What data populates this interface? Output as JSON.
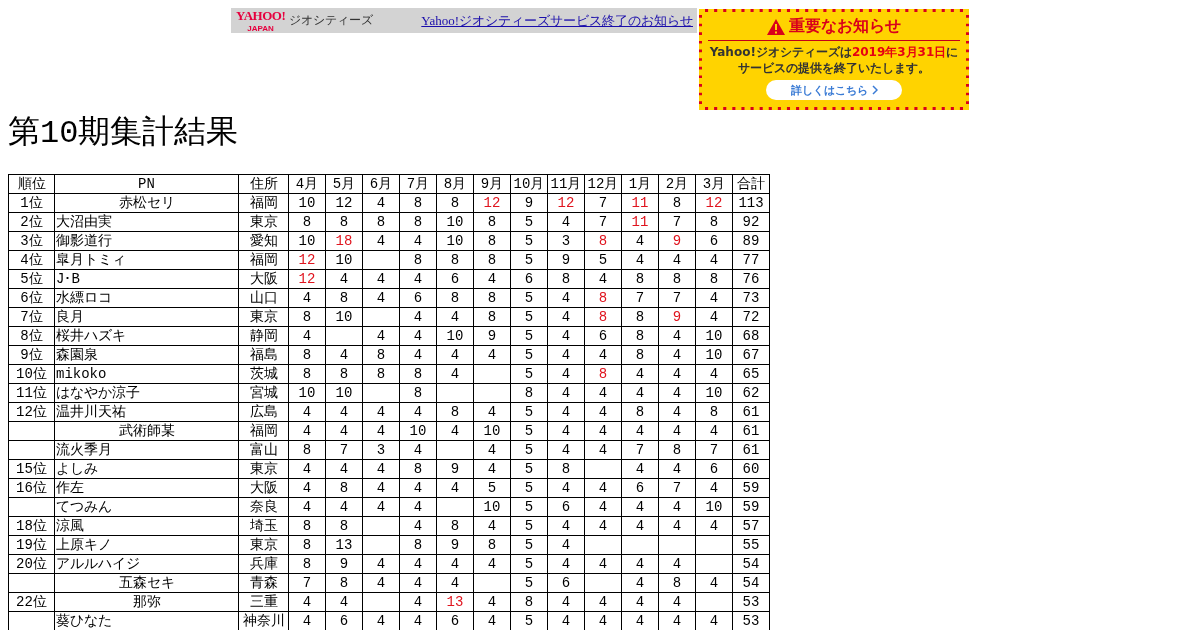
{
  "topbar": {
    "logo": "YAHOO!",
    "logo_sub": "JAPAN",
    "service": "ジオシティーズ",
    "link": "Yahoo!ジオシティーズサービス終了のお知らせ"
  },
  "notice": {
    "title": "重要なお知らせ",
    "message_before": "Yahoo!ジオシティーズは",
    "date": "2019年3月31日",
    "message_mid": "に",
    "message_after": "サービスの提供を終了いたします。",
    "button": "詳しくはこちら"
  },
  "heading": "第10期集計結果",
  "table": {
    "columns": [
      "順位",
      "PN",
      "住所",
      "4月",
      "5月",
      "6月",
      "7月",
      "8月",
      "9月",
      "10月",
      "11月",
      "12月",
      "1月",
      "2月",
      "3月",
      "合計"
    ],
    "rows": [
      {
        "rank": "1位",
        "name": "赤松セリ",
        "centered": true,
        "place": "福岡",
        "scores": [
          {
            "kind": "score",
            "text": "10",
            "highlight": false
          },
          {
            "kind": "score",
            "text": "12",
            "highlight": false
          },
          {
            "kind": "score",
            "text": "4",
            "highlight": false
          },
          {
            "kind": "score",
            "text": "8",
            "highlight": false
          },
          {
            "kind": "score",
            "text": "8",
            "highlight": false
          },
          {
            "kind": "score",
            "text": "12",
            "highlight": true
          },
          {
            "kind": "score",
            "text": "9",
            "highlight": false
          },
          {
            "kind": "score",
            "text": "12",
            "highlight": true
          },
          {
            "kind": "score",
            "text": "7",
            "highlight": false
          },
          {
            "kind": "score",
            "text": "11",
            "highlight": true
          },
          {
            "kind": "score",
            "text": "8",
            "highlight": false
          },
          {
            "kind": "score",
            "text": "12",
            "highlight": true
          }
        ],
        "total": "113"
      },
      {
        "rank": "2位",
        "name": "大沼由実",
        "centered": false,
        "place": "東京",
        "scores": [
          {
            "kind": "score",
            "text": "8",
            "highlight": false
          },
          {
            "kind": "score",
            "text": "8",
            "highlight": false
          },
          {
            "kind": "score",
            "text": "8",
            "highlight": false
          },
          {
            "kind": "score",
            "text": "8",
            "highlight": false
          },
          {
            "kind": "score",
            "text": "10",
            "highlight": false
          },
          {
            "kind": "score",
            "text": "8",
            "highlight": false
          },
          {
            "kind": "score",
            "text": "5",
            "highlight": false
          },
          {
            "kind": "score",
            "text": "4",
            "highlight": false
          },
          {
            "kind": "score",
            "text": "7",
            "highlight": false
          },
          {
            "kind": "score",
            "text": "11",
            "highlight": true
          },
          {
            "kind": "score",
            "text": "7",
            "highlight": false
          },
          {
            "kind": "score",
            "text": "8",
            "highlight": false
          }
        ],
        "total": "92"
      },
      {
        "rank": "3位",
        "name": "御影道行",
        "centered": false,
        "place": "愛知",
        "scores": [
          {
            "kind": "score",
            "text": "10",
            "highlight": false
          },
          {
            "kind": "score",
            "text": "18",
            "highlight": true
          },
          {
            "kind": "score",
            "text": "4",
            "highlight": false
          },
          {
            "kind": "score",
            "text": "4",
            "highlight": false
          },
          {
            "kind": "score",
            "text": "10",
            "highlight": false
          },
          {
            "kind": "score",
            "text": "8",
            "highlight": false
          },
          {
            "kind": "score",
            "text": "5",
            "highlight": false
          },
          {
            "kind": "score",
            "text": "3",
            "highlight": false
          },
          {
            "kind": "score",
            "text": "8",
            "highlight": true
          },
          {
            "kind": "score",
            "text": "4",
            "highlight": false
          },
          {
            "kind": "score",
            "text": "9",
            "highlight": true
          },
          {
            "kind": "score",
            "text": "6",
            "highlight": false
          }
        ],
        "total": "89"
      },
      {
        "rank": "4位",
        "name": "皐月トミィ",
        "centered": false,
        "place": "福岡",
        "scores": [
          {
            "kind": "score",
            "text": "12",
            "highlight": true
          },
          {
            "kind": "score",
            "text": "10",
            "highlight": false
          },
          {
            "kind": "blank"
          },
          {
            "kind": "score",
            "text": "8",
            "highlight": false
          },
          {
            "kind": "score",
            "text": "8",
            "highlight": false
          },
          {
            "kind": "score",
            "text": "8",
            "highlight": false
          },
          {
            "kind": "score",
            "text": "5",
            "highlight": false
          },
          {
            "kind": "score",
            "text": "9",
            "highlight": false
          },
          {
            "kind": "score",
            "text": "5",
            "highlight": false
          },
          {
            "kind": "score",
            "text": "4",
            "highlight": false
          },
          {
            "kind": "score",
            "text": "4",
            "highlight": false
          },
          {
            "kind": "score",
            "text": "4",
            "highlight": false
          }
        ],
        "total": "77"
      },
      {
        "rank": "5位",
        "name": "J･B",
        "centered": false,
        "place": "大阪",
        "scores": [
          {
            "kind": "score",
            "text": "12",
            "highlight": true
          },
          {
            "kind": "score",
            "text": "4",
            "highlight": false
          },
          {
            "kind": "score",
            "text": "4",
            "highlight": false
          },
          {
            "kind": "score",
            "text": "4",
            "highlight": false
          },
          {
            "kind": "score",
            "text": "6",
            "highlight": false
          },
          {
            "kind": "score",
            "text": "4",
            "highlight": false
          },
          {
            "kind": "score",
            "text": "6",
            "highlight": false
          },
          {
            "kind": "score",
            "text": "8",
            "highlight": false
          },
          {
            "kind": "score",
            "text": "4",
            "highlight": false
          },
          {
            "kind": "score",
            "text": "8",
            "highlight": false
          },
          {
            "kind": "score",
            "text": "8",
            "highlight": false
          },
          {
            "kind": "score",
            "text": "8",
            "highlight": false
          }
        ],
        "total": "76"
      },
      {
        "rank": "6位",
        "name": "水縹ロコ",
        "centered": false,
        "place": "山口",
        "scores": [
          {
            "kind": "score",
            "text": "4",
            "highlight": false
          },
          {
            "kind": "score",
            "text": "8",
            "highlight": false
          },
          {
            "kind": "score",
            "text": "4",
            "highlight": false
          },
          {
            "kind": "score",
            "text": "6",
            "highlight": false
          },
          {
            "kind": "score",
            "text": "8",
            "highlight": false
          },
          {
            "kind": "score",
            "text": "8",
            "highlight": false
          },
          {
            "kind": "score",
            "text": "5",
            "highlight": false
          },
          {
            "kind": "score",
            "text": "4",
            "highlight": false
          },
          {
            "kind": "score",
            "text": "8",
            "highlight": true
          },
          {
            "kind": "score",
            "text": "7",
            "highlight": false
          },
          {
            "kind": "score",
            "text": "7",
            "highlight": false
          },
          {
            "kind": "score",
            "text": "4",
            "highlight": false
          }
        ],
        "total": "73"
      },
      {
        "rank": "7位",
        "name": "良月",
        "centered": false,
        "place": "東京",
        "scores": [
          {
            "kind": "score",
            "text": "8",
            "highlight": false
          },
          {
            "kind": "score",
            "text": "10",
            "highlight": false
          },
          {
            "kind": "blank"
          },
          {
            "kind": "score",
            "text": "4",
            "highlight": false
          },
          {
            "kind": "score",
            "text": "4",
            "highlight": false
          },
          {
            "kind": "score",
            "text": "8",
            "highlight": false
          },
          {
            "kind": "score",
            "text": "5",
            "highlight": false
          },
          {
            "kind": "score",
            "text": "4",
            "highlight": false
          },
          {
            "kind": "score",
            "text": "8",
            "highlight": true
          },
          {
            "kind": "score",
            "text": "8",
            "highlight": false
          },
          {
            "kind": "score",
            "text": "9",
            "highlight": true
          },
          {
            "kind": "score",
            "text": "4",
            "highlight": false
          }
        ],
        "total": "72"
      },
      {
        "rank": "8位",
        "name": "桜井ハズキ",
        "centered": false,
        "place": "静岡",
        "scores": [
          {
            "kind": "score",
            "text": "4",
            "highlight": false
          },
          {
            "kind": "blank"
          },
          {
            "kind": "score",
            "text": "4",
            "highlight": false
          },
          {
            "kind": "score",
            "text": "4",
            "highlight": false
          },
          {
            "kind": "score",
            "text": "10",
            "highlight": false
          },
          {
            "kind": "score",
            "text": "9",
            "highlight": false
          },
          {
            "kind": "score",
            "text": "5",
            "highlight": false
          },
          {
            "kind": "score",
            "text": "4",
            "highlight": false
          },
          {
            "kind": "score",
            "text": "6",
            "highlight": false
          },
          {
            "kind": "score",
            "text": "8",
            "highlight": false
          },
          {
            "kind": "score",
            "text": "4",
            "highlight": false
          },
          {
            "kind": "score",
            "text": "10",
            "highlight": false
          }
        ],
        "total": "68"
      },
      {
        "rank": "9位",
        "name": "森園泉",
        "centered": false,
        "place": "福島",
        "scores": [
          {
            "kind": "score",
            "text": "8",
            "highlight": false
          },
          {
            "kind": "score",
            "text": "4",
            "highlight": false
          },
          {
            "kind": "score",
            "text": "8",
            "highlight": false
          },
          {
            "kind": "score",
            "text": "4",
            "highlight": false
          },
          {
            "kind": "score",
            "text": "4",
            "highlight": false
          },
          {
            "kind": "score",
            "text": "4",
            "highlight": false
          },
          {
            "kind": "score",
            "text": "5",
            "highlight": false
          },
          {
            "kind": "score",
            "text": "4",
            "highlight": false
          },
          {
            "kind": "score",
            "text": "4",
            "highlight": false
          },
          {
            "kind": "score",
            "text": "8",
            "highlight": false
          },
          {
            "kind": "score",
            "text": "4",
            "highlight": false
          },
          {
            "kind": "score",
            "text": "10",
            "highlight": false
          }
        ],
        "total": "67"
      },
      {
        "rank": "10位",
        "name": "mikoko",
        "centered": false,
        "place": "茨城",
        "scores": [
          {
            "kind": "score",
            "text": "8",
            "highlight": false
          },
          {
            "kind": "score",
            "text": "8",
            "highlight": false
          },
          {
            "kind": "score",
            "text": "8",
            "highlight": false
          },
          {
            "kind": "score",
            "text": "8",
            "highlight": false
          },
          {
            "kind": "score",
            "text": "4",
            "highlight": false
          },
          {
            "kind": "blank"
          },
          {
            "kind": "score",
            "text": "5",
            "highlight": false
          },
          {
            "kind": "score",
            "text": "4",
            "highlight": false
          },
          {
            "kind": "score",
            "text": "8",
            "highlight": true
          },
          {
            "kind": "score",
            "text": "4",
            "highlight": false
          },
          {
            "kind": "score",
            "text": "4",
            "highlight": false
          },
          {
            "kind": "score",
            "text": "4",
            "highlight": false
          }
        ],
        "total": "65"
      },
      {
        "rank": "11位",
        "name": "はなやか涼子",
        "centered": false,
        "place": "宮城",
        "scores": [
          {
            "kind": "score",
            "text": "10",
            "highlight": false
          },
          {
            "kind": "score",
            "text": "10",
            "highlight": false
          },
          {
            "kind": "blank"
          },
          {
            "kind": "score",
            "text": "8",
            "highlight": false
          },
          {
            "kind": "blank"
          },
          {
            "kind": "blank"
          },
          {
            "kind": "score",
            "text": "8",
            "highlight": false
          },
          {
            "kind": "score",
            "text": "4",
            "highlight": false
          },
          {
            "kind": "score",
            "text": "4",
            "highlight": false
          },
          {
            "kind": "score",
            "text": "4",
            "highlight": false
          },
          {
            "kind": "score",
            "text": "4",
            "highlight": false
          },
          {
            "kind": "score",
            "text": "10",
            "highlight": false
          }
        ],
        "total": "62"
      },
      {
        "rank": "12位",
        "name": "温井川天祐",
        "centered": false,
        "place": "広島",
        "scores": [
          {
            "kind": "score",
            "text": "4",
            "highlight": false
          },
          {
            "kind": "score",
            "text": "4",
            "highlight": false
          },
          {
            "kind": "score",
            "text": "4",
            "highlight": false
          },
          {
            "kind": "score",
            "text": "4",
            "highlight": false
          },
          {
            "kind": "score",
            "text": "8",
            "highlight": false
          },
          {
            "kind": "score",
            "text": "4",
            "highlight": false
          },
          {
            "kind": "score",
            "text": "5",
            "highlight": false
          },
          {
            "kind": "score",
            "text": "4",
            "highlight": false
          },
          {
            "kind": "score",
            "text": "4",
            "highlight": false
          },
          {
            "kind": "score",
            "text": "8",
            "highlight": false
          },
          {
            "kind": "score",
            "text": "4",
            "highlight": false
          },
          {
            "kind": "score",
            "text": "8",
            "highlight": false
          }
        ],
        "total": "61"
      },
      {
        "name": "武術師某",
        "centered": true,
        "place": "福岡",
        "scores": [
          {
            "kind": "score",
            "text": "4",
            "highlight": false
          },
          {
            "kind": "score",
            "text": "4",
            "highlight": false
          },
          {
            "kind": "score",
            "text": "4",
            "highlight": false
          },
          {
            "kind": "score",
            "text": "10",
            "highlight": false
          },
          {
            "kind": "score",
            "text": "4",
            "highlight": false
          },
          {
            "kind": "score",
            "text": "10",
            "highlight": false
          },
          {
            "kind": "score",
            "text": "5",
            "highlight": false
          },
          {
            "kind": "score",
            "text": "4",
            "highlight": false
          },
          {
            "kind": "score",
            "text": "4",
            "highlight": false
          },
          {
            "kind": "score",
            "text": "4",
            "highlight": false
          },
          {
            "kind": "score",
            "text": "4",
            "highlight": false
          },
          {
            "kind": "score",
            "text": "4",
            "highlight": false
          }
        ],
        "total": "61"
      },
      {
        "name": "流火季月",
        "centered": false,
        "place": "富山",
        "scores": [
          {
            "kind": "score",
            "text": "8",
            "highlight": false
          },
          {
            "kind": "score",
            "text": "7",
            "highlight": false
          },
          {
            "kind": "score",
            "text": "3",
            "highlight": false
          },
          {
            "kind": "score",
            "text": "4",
            "highlight": false
          },
          {
            "kind": "blank"
          },
          {
            "kind": "score",
            "text": "4",
            "highlight": false
          },
          {
            "kind": "score",
            "text": "5",
            "highlight": false
          },
          {
            "kind": "score",
            "text": "4",
            "highlight": false
          },
          {
            "kind": "score",
            "text": "4",
            "highlight": false
          },
          {
            "kind": "score",
            "text": "7",
            "highlight": false
          },
          {
            "kind": "score",
            "text": "8",
            "highlight": false
          },
          {
            "kind": "score",
            "text": "7",
            "highlight": false
          }
        ],
        "total": "61"
      },
      {
        "rank": "15位",
        "name": "よしみ",
        "centered": false,
        "place": "東京",
        "scores": [
          {
            "kind": "score",
            "text": "4",
            "highlight": false
          },
          {
            "kind": "score",
            "text": "4",
            "highlight": false
          },
          {
            "kind": "score",
            "text": "4",
            "highlight": false
          },
          {
            "kind": "score",
            "text": "8",
            "highlight": false
          },
          {
            "kind": "score",
            "text": "9",
            "highlight": false
          },
          {
            "kind": "score",
            "text": "4",
            "highlight": false
          },
          {
            "kind": "score",
            "text": "5",
            "highlight": false
          },
          {
            "kind": "score",
            "text": "8",
            "highlight": false
          },
          {
            "kind": "blank"
          },
          {
            "kind": "score",
            "text": "4",
            "highlight": false
          },
          {
            "kind": "score",
            "text": "4",
            "highlight": false
          },
          {
            "kind": "score",
            "text": "6",
            "highlight": false
          }
        ],
        "total": "60"
      },
      {
        "rank": "16位",
        "name": "作左",
        "centered": false,
        "place": "大阪",
        "scores": [
          {
            "kind": "score",
            "text": "4",
            "highlight": false
          },
          {
            "kind": "score",
            "text": "8",
            "highlight": false
          },
          {
            "kind": "score",
            "text": "4",
            "highlight": false
          },
          {
            "kind": "score",
            "text": "4",
            "highlight": false
          },
          {
            "kind": "score",
            "text": "4",
            "highlight": false
          },
          {
            "kind": "score",
            "text": "5",
            "highlight": false
          },
          {
            "kind": "score",
            "text": "5",
            "highlight": false
          },
          {
            "kind": "score",
            "text": "4",
            "highlight": false
          },
          {
            "kind": "score",
            "text": "4",
            "highlight": false
          },
          {
            "kind": "score",
            "text": "6",
            "highlight": false
          },
          {
            "kind": "score",
            "text": "7",
            "highlight": false
          },
          {
            "kind": "score",
            "text": "4",
            "highlight": false
          }
        ],
        "total": "59"
      },
      {
        "name": "てつみん",
        "centered": false,
        "place": "奈良",
        "scores": [
          {
            "kind": "score",
            "text": "4",
            "highlight": false
          },
          {
            "kind": "score",
            "text": "4",
            "highlight": false
          },
          {
            "kind": "score",
            "text": "4",
            "highlight": false
          },
          {
            "kind": "score",
            "text": "4",
            "highlight": false
          },
          {
            "kind": "blank"
          },
          {
            "kind": "score",
            "text": "10",
            "highlight": false
          },
          {
            "kind": "score",
            "text": "5",
            "highlight": false
          },
          {
            "kind": "score",
            "text": "6",
            "highlight": false
          },
          {
            "kind": "score",
            "text": "4",
            "highlight": false
          },
          {
            "kind": "score",
            "text": "4",
            "highlight": false
          },
          {
            "kind": "score",
            "text": "4",
            "highlight": false
          },
          {
            "kind": "score",
            "text": "10",
            "highlight": false
          }
        ],
        "total": "59"
      },
      {
        "rank": "18位",
        "name": "涼風",
        "centered": false,
        "place": "埼玉",
        "scores": [
          {
            "kind": "score",
            "text": "8",
            "highlight": false
          },
          {
            "kind": "score",
            "text": "8",
            "highlight": false
          },
          {
            "kind": "blank"
          },
          {
            "kind": "score",
            "text": "4",
            "highlight": false
          },
          {
            "kind": "score",
            "text": "8",
            "highlight": false
          },
          {
            "kind": "score",
            "text": "4",
            "highlight": false
          },
          {
            "kind": "score",
            "text": "5",
            "highlight": false
          },
          {
            "kind": "score",
            "text": "4",
            "highlight": false
          },
          {
            "kind": "score",
            "text": "4",
            "highlight": false
          },
          {
            "kind": "score",
            "text": "4",
            "highlight": false
          },
          {
            "kind": "score",
            "text": "4",
            "highlight": false
          },
          {
            "kind": "score",
            "text": "4",
            "highlight": false
          }
        ],
        "total": "57"
      },
      {
        "rank": "19位",
        "name": "上原キノ",
        "centered": false,
        "place": "東京",
        "scores": [
          {
            "kind": "score",
            "text": "8",
            "highlight": false
          },
          {
            "kind": "score",
            "text": "13",
            "highlight": false
          },
          {
            "kind": "blank"
          },
          {
            "kind": "score",
            "text": "8",
            "highlight": false
          },
          {
            "kind": "score",
            "text": "9",
            "highlight": false
          },
          {
            "kind": "score",
            "text": "8",
            "highlight": false
          },
          {
            "kind": "score",
            "text": "5",
            "highlight": false
          },
          {
            "kind": "score",
            "text": "4",
            "highlight": false
          },
          {
            "kind": "blank"
          },
          {
            "kind": "blank"
          },
          {
            "kind": "blank"
          },
          {
            "kind": "blank"
          }
        ],
        "total": "55"
      },
      {
        "rank": "20位",
        "name": "アルルハイジ",
        "centered": false,
        "place": "兵庫",
        "scores": [
          {
            "kind": "score",
            "text": "8",
            "highlight": false
          },
          {
            "kind": "score",
            "text": "9",
            "highlight": false
          },
          {
            "kind": "score",
            "text": "4",
            "highlight": false
          },
          {
            "kind": "score",
            "text": "4",
            "highlight": false
          },
          {
            "kind": "score",
            "text": "4",
            "highlight": false
          },
          {
            "kind": "score",
            "text": "4",
            "highlight": false
          },
          {
            "kind": "score",
            "text": "5",
            "highlight": false
          },
          {
            "kind": "score",
            "text": "4",
            "highlight": false
          },
          {
            "kind": "score",
            "text": "4",
            "highlight": false
          },
          {
            "kind": "score",
            "text": "4",
            "highlight": false
          },
          {
            "kind": "score",
            "text": "4",
            "highlight": false
          },
          {
            "kind": "blank"
          }
        ],
        "total": "54"
      },
      {
        "name": "五森セキ",
        "centered": true,
        "place": "青森",
        "scores": [
          {
            "kind": "score",
            "text": "7",
            "highlight": false
          },
          {
            "kind": "score",
            "text": "8",
            "highlight": false
          },
          {
            "kind": "score",
            "text": "4",
            "highlight": false
          },
          {
            "kind": "score",
            "text": "4",
            "highlight": false
          },
          {
            "kind": "score",
            "text": "4",
            "highlight": false
          },
          {
            "kind": "blank"
          },
          {
            "kind": "score",
            "text": "5",
            "highlight": false
          },
          {
            "kind": "score",
            "text": "6",
            "highlight": false
          },
          {
            "kind": "blank"
          },
          {
            "kind": "score",
            "text": "4",
            "highlight": false
          },
          {
            "kind": "score",
            "text": "8",
            "highlight": false
          },
          {
            "kind": "score",
            "text": "4",
            "highlight": false
          }
        ],
        "total": "54"
      },
      {
        "rank": "22位",
        "name": "那弥",
        "centered": true,
        "place": "三重",
        "scores": [
          {
            "kind": "score",
            "text": "4",
            "highlight": false
          },
          {
            "kind": "score",
            "text": "4",
            "highlight": false
          },
          {
            "kind": "blank"
          },
          {
            "kind": "score",
            "text": "4",
            "highlight": false
          },
          {
            "kind": "score",
            "text": "13",
            "highlight": true
          },
          {
            "kind": "score",
            "text": "4",
            "highlight": false
          },
          {
            "kind": "score",
            "text": "8",
            "highlight": false
          },
          {
            "kind": "score",
            "text": "4",
            "highlight": false
          },
          {
            "kind": "score",
            "text": "4",
            "highlight": false
          },
          {
            "kind": "score",
            "text": "4",
            "highlight": false
          },
          {
            "kind": "score",
            "text": "4",
            "highlight": false
          },
          {
            "kind": "blank"
          }
        ],
        "total": "53"
      },
      {
        "name": "葵ひなた",
        "centered": false,
        "place": "神奈川",
        "scores": [
          {
            "kind": "score",
            "text": "4",
            "highlight": false
          },
          {
            "kind": "score",
            "text": "6",
            "highlight": false
          },
          {
            "kind": "score",
            "text": "4",
            "highlight": false
          },
          {
            "kind": "score",
            "text": "4",
            "highlight": false
          },
          {
            "kind": "score",
            "text": "6",
            "highlight": false
          },
          {
            "kind": "score",
            "text": "4",
            "highlight": false
          },
          {
            "kind": "score",
            "text": "5",
            "highlight": false
          },
          {
            "kind": "score",
            "text": "4",
            "highlight": false
          },
          {
            "kind": "score",
            "text": "4",
            "highlight": false
          },
          {
            "kind": "score",
            "text": "4",
            "highlight": false
          },
          {
            "kind": "score",
            "text": "4",
            "highlight": false
          },
          {
            "kind": "score",
            "text": "4",
            "highlight": false
          }
        ],
        "total": "53"
      }
    ]
  }
}
